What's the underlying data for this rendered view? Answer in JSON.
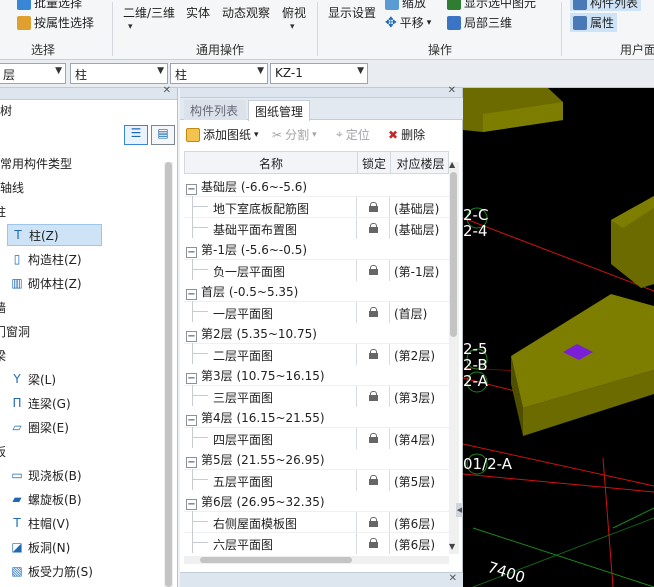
{
  "ribbon": {
    "groups": [
      {
        "label": "选择"
      },
      {
        "label": "通用操作"
      },
      {
        "label": "操作"
      },
      {
        "label": "用户面"
      }
    ],
    "batch_select": "批量选择",
    "attr_select": "按属性选择",
    "view_2d3d": "二维/三维",
    "solid": "实体",
    "dynamic_view": "动态观察",
    "top_view": "俯视",
    "display_settings": "显示设置",
    "zoom": "缩放",
    "pan": "平移",
    "show_selected": "显示选中图元",
    "local_3d": "局部三维",
    "component_list": "构件列表",
    "properties": "属性"
  },
  "propbar": {
    "floor": "层",
    "category": "柱",
    "type": "柱",
    "name": "KZ-1"
  },
  "left_panel": {
    "title": "树",
    "items": [
      {
        "label": "常用构件类型"
      },
      {
        "label": "轴线"
      },
      {
        "label": "柱"
      },
      {
        "label": "柱(Z)",
        "icon": "column-icon"
      },
      {
        "label": "构造柱(Z)",
        "icon": "constructional-column-icon"
      },
      {
        "label": "砌体柱(Z)",
        "icon": "masonry-column-icon"
      },
      {
        "label": "墙"
      },
      {
        "label": "门窗洞"
      },
      {
        "label": "梁"
      },
      {
        "label": "梁(L)",
        "icon": "beam-icon"
      },
      {
        "label": "连梁(G)",
        "icon": "link-beam-icon"
      },
      {
        "label": "圈梁(E)",
        "icon": "ring-beam-icon"
      },
      {
        "label": "板"
      },
      {
        "label": "现浇板(B)",
        "icon": "cast-slab-icon"
      },
      {
        "label": "螺旋板(B)",
        "icon": "spiral-slab-icon"
      },
      {
        "label": "柱帽(V)",
        "icon": "column-cap-icon"
      },
      {
        "label": "板洞(N)",
        "icon": "slab-hole-icon"
      },
      {
        "label": "板受力筋(S)",
        "icon": "slab-rebar-icon"
      }
    ]
  },
  "drawing_panel": {
    "tabs": [
      {
        "label": "构件列表"
      },
      {
        "label": "图纸管理"
      }
    ],
    "toolbar": {
      "add": "添加图纸",
      "split": "分割",
      "locate": "定位",
      "delete": "删除"
    },
    "columns": {
      "name": "名称",
      "lock": "锁定",
      "floor": "对应楼层"
    },
    "rows": [
      {
        "kind": "group",
        "label": "基础层 (-6.6~-5.6)"
      },
      {
        "kind": "item",
        "label": "地下室底板配筋图",
        "floor": "(基础层)"
      },
      {
        "kind": "item",
        "label": "基础平面布置图",
        "floor": "(基础层)"
      },
      {
        "kind": "group",
        "label": "第-1层 (-5.6~-0.5)"
      },
      {
        "kind": "item",
        "label": "负一层平面图",
        "floor": "(第-1层)"
      },
      {
        "kind": "group",
        "label": "首层 (-0.5~5.35)"
      },
      {
        "kind": "item",
        "label": "一层平面图",
        "floor": "(首层)"
      },
      {
        "kind": "group",
        "label": "第2层 (5.35~10.75)"
      },
      {
        "kind": "item",
        "label": "二层平面图",
        "floor": "(第2层)"
      },
      {
        "kind": "group",
        "label": "第3层 (10.75~16.15)"
      },
      {
        "kind": "item",
        "label": "三层平面图",
        "floor": "(第3层)"
      },
      {
        "kind": "group",
        "label": "第4层 (16.15~21.55)"
      },
      {
        "kind": "item",
        "label": "四层平面图",
        "floor": "(第4层)"
      },
      {
        "kind": "group",
        "label": "第5层 (21.55~26.95)"
      },
      {
        "kind": "item",
        "label": "五层平面图",
        "floor": "(第5层)"
      },
      {
        "kind": "group",
        "label": "第6层 (26.95~32.35)"
      },
      {
        "kind": "item",
        "label": "右侧屋面模板图",
        "floor": "(第6层)"
      },
      {
        "kind": "item",
        "label": "六层平面图",
        "floor": "(第6层)"
      }
    ]
  },
  "viewport": {
    "labels": [
      {
        "text": "2-C"
      },
      {
        "text": "2-4"
      },
      {
        "text": "2-5"
      },
      {
        "text": "2-B"
      },
      {
        "text": "2-A"
      },
      {
        "text": "01/2-A"
      },
      {
        "text": "7400"
      }
    ]
  },
  "colors": {
    "slab": "#6b6b00",
    "slab_dark": "#4f4f00",
    "selected": "#7a1fd6",
    "axis_red": "#d01010",
    "axis_green": "#1a8a1a"
  }
}
